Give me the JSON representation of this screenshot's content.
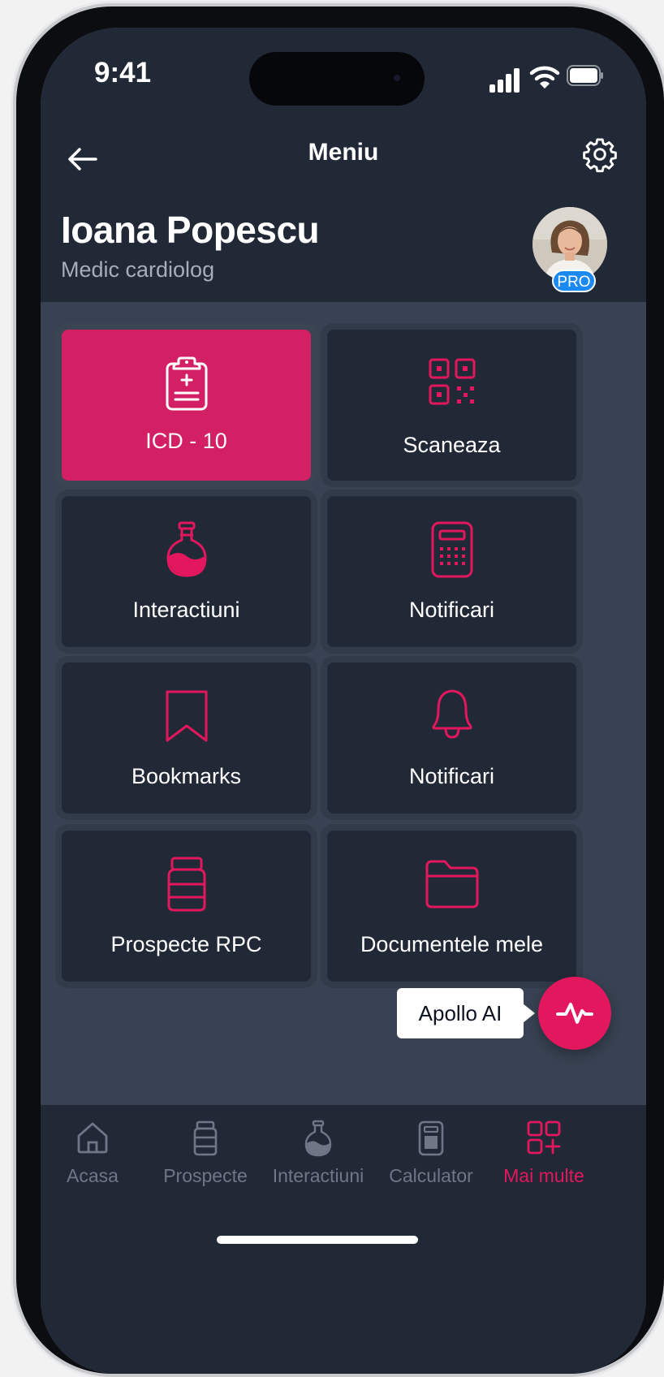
{
  "status_bar": {
    "time": "9:41"
  },
  "nav": {
    "title": "Meniu"
  },
  "profile": {
    "name": "Ioana Popescu",
    "role": "Medic cardiolog",
    "badge": "PRO"
  },
  "tiles": [
    {
      "label": "ICD - 10",
      "icon": "clipboard-plus-icon",
      "active": true
    },
    {
      "label": "Scaneaza",
      "icon": "qr-code-icon"
    },
    {
      "label": "Interactiuni",
      "icon": "flask-icon"
    },
    {
      "label": "Notificari",
      "icon": "calculator-icon"
    },
    {
      "label": "Bookmarks",
      "icon": "bookmark-icon"
    },
    {
      "label": "Notificari",
      "icon": "bell-icon"
    },
    {
      "label": "Prospecte RPC",
      "icon": "pill-bottle-icon"
    },
    {
      "label": "Documentele mele",
      "icon": "folder-icon"
    }
  ],
  "assistant": {
    "label": "Apollo AI",
    "icon": "pulse-icon"
  },
  "tabbar": [
    {
      "label": "Acasa",
      "icon": "home-icon"
    },
    {
      "label": "Prospecte",
      "icon": "pill-bottle-icon"
    },
    {
      "label": "Interactiuni",
      "icon": "flask-icon"
    },
    {
      "label": "Calculator",
      "icon": "calculator-icon"
    },
    {
      "label": "Mai multe",
      "icon": "grid-plus-icon",
      "active": true
    }
  ],
  "colors": {
    "accent": "#e2175e",
    "tile_active": "#d31f63",
    "surface": "#212937",
    "background": "#384252",
    "badge": "#1a8af2"
  }
}
